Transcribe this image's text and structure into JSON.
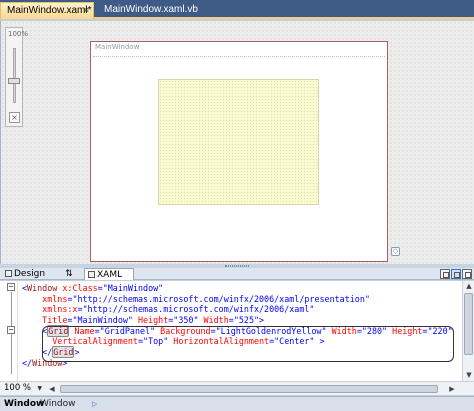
{
  "tabs": [
    {
      "label": "MainWindow.xaml*",
      "active": true,
      "close": "×"
    },
    {
      "label": "MainWindow.xaml.vb",
      "active": false
    }
  ],
  "designer": {
    "zoom_percent_label": "100%",
    "reset_label": "×",
    "window_title": "MainWindow",
    "resize_grip_glyph": "◇",
    "colors": {
      "grid_background": "#fafad2",
      "window_border": "#a85f5f"
    }
  },
  "view_tabs": {
    "design": "Design",
    "swap": "⇅",
    "xaml": "XAML"
  },
  "code": {
    "fold_minus": "−",
    "lines": [
      {
        "parts": [
          [
            "br",
            "<"
          ],
          [
            "tag",
            "Window"
          ],
          [
            "at",
            " x:Class"
          ],
          [
            "br",
            "="
          ],
          [
            "val",
            "\"MainWindow\""
          ]
        ]
      },
      {
        "parts": [
          [
            "at",
            "    xmlns"
          ],
          [
            "br",
            "="
          ],
          [
            "val",
            "\"http://schemas.microsoft.com/winfx/2006/xaml/presentation\""
          ]
        ]
      },
      {
        "parts": [
          [
            "at",
            "    xmlns:x"
          ],
          [
            "br",
            "="
          ],
          [
            "val",
            "\"http://schemas.microsoft.com/winfx/2006/xaml\""
          ]
        ]
      },
      {
        "parts": [
          [
            "at",
            "    Title"
          ],
          [
            "br",
            "="
          ],
          [
            "val",
            "\"MainWindow\""
          ],
          [
            "at",
            " Height"
          ],
          [
            "br",
            "="
          ],
          [
            "val",
            "\"350\""
          ],
          [
            "at",
            " Width"
          ],
          [
            "br",
            "="
          ],
          [
            "val",
            "\"525\""
          ],
          [
            "br",
            ">"
          ]
        ]
      },
      {
        "parts": [
          [
            "br",
            "    <"
          ],
          [
            "tag",
            "Grid"
          ],
          [
            "at",
            " Name"
          ],
          [
            "br",
            "="
          ],
          [
            "val",
            "\"GridPanel\""
          ],
          [
            "at",
            " Background"
          ],
          [
            "br",
            "="
          ],
          [
            "val",
            "\"LightGoldenrodYellow\""
          ],
          [
            "at",
            " Width"
          ],
          [
            "br",
            "="
          ],
          [
            "val",
            "\"280\""
          ],
          [
            "at",
            " Height"
          ],
          [
            "br",
            "="
          ],
          [
            "val",
            "\"220\""
          ]
        ]
      },
      {
        "parts": [
          [
            "at",
            "      VerticalAlignment"
          ],
          [
            "br",
            "="
          ],
          [
            "val",
            "\"Top\""
          ],
          [
            "at",
            " HorizontalAlignment"
          ],
          [
            "br",
            "="
          ],
          [
            "val",
            "\"Center\""
          ],
          [
            "br",
            " >"
          ]
        ]
      },
      {
        "parts": [
          [
            "br",
            "    </"
          ],
          [
            "tag",
            "Grid"
          ],
          [
            "br",
            ">"
          ]
        ]
      },
      {
        "parts": [
          [
            "br",
            "</"
          ],
          [
            "tag",
            "Window"
          ],
          [
            "br",
            ">"
          ]
        ]
      }
    ]
  },
  "status": {
    "zoom": "100 %"
  },
  "tag_navigator": {
    "items": [
      "Window",
      "Window"
    ],
    "arrow": "▷"
  }
}
